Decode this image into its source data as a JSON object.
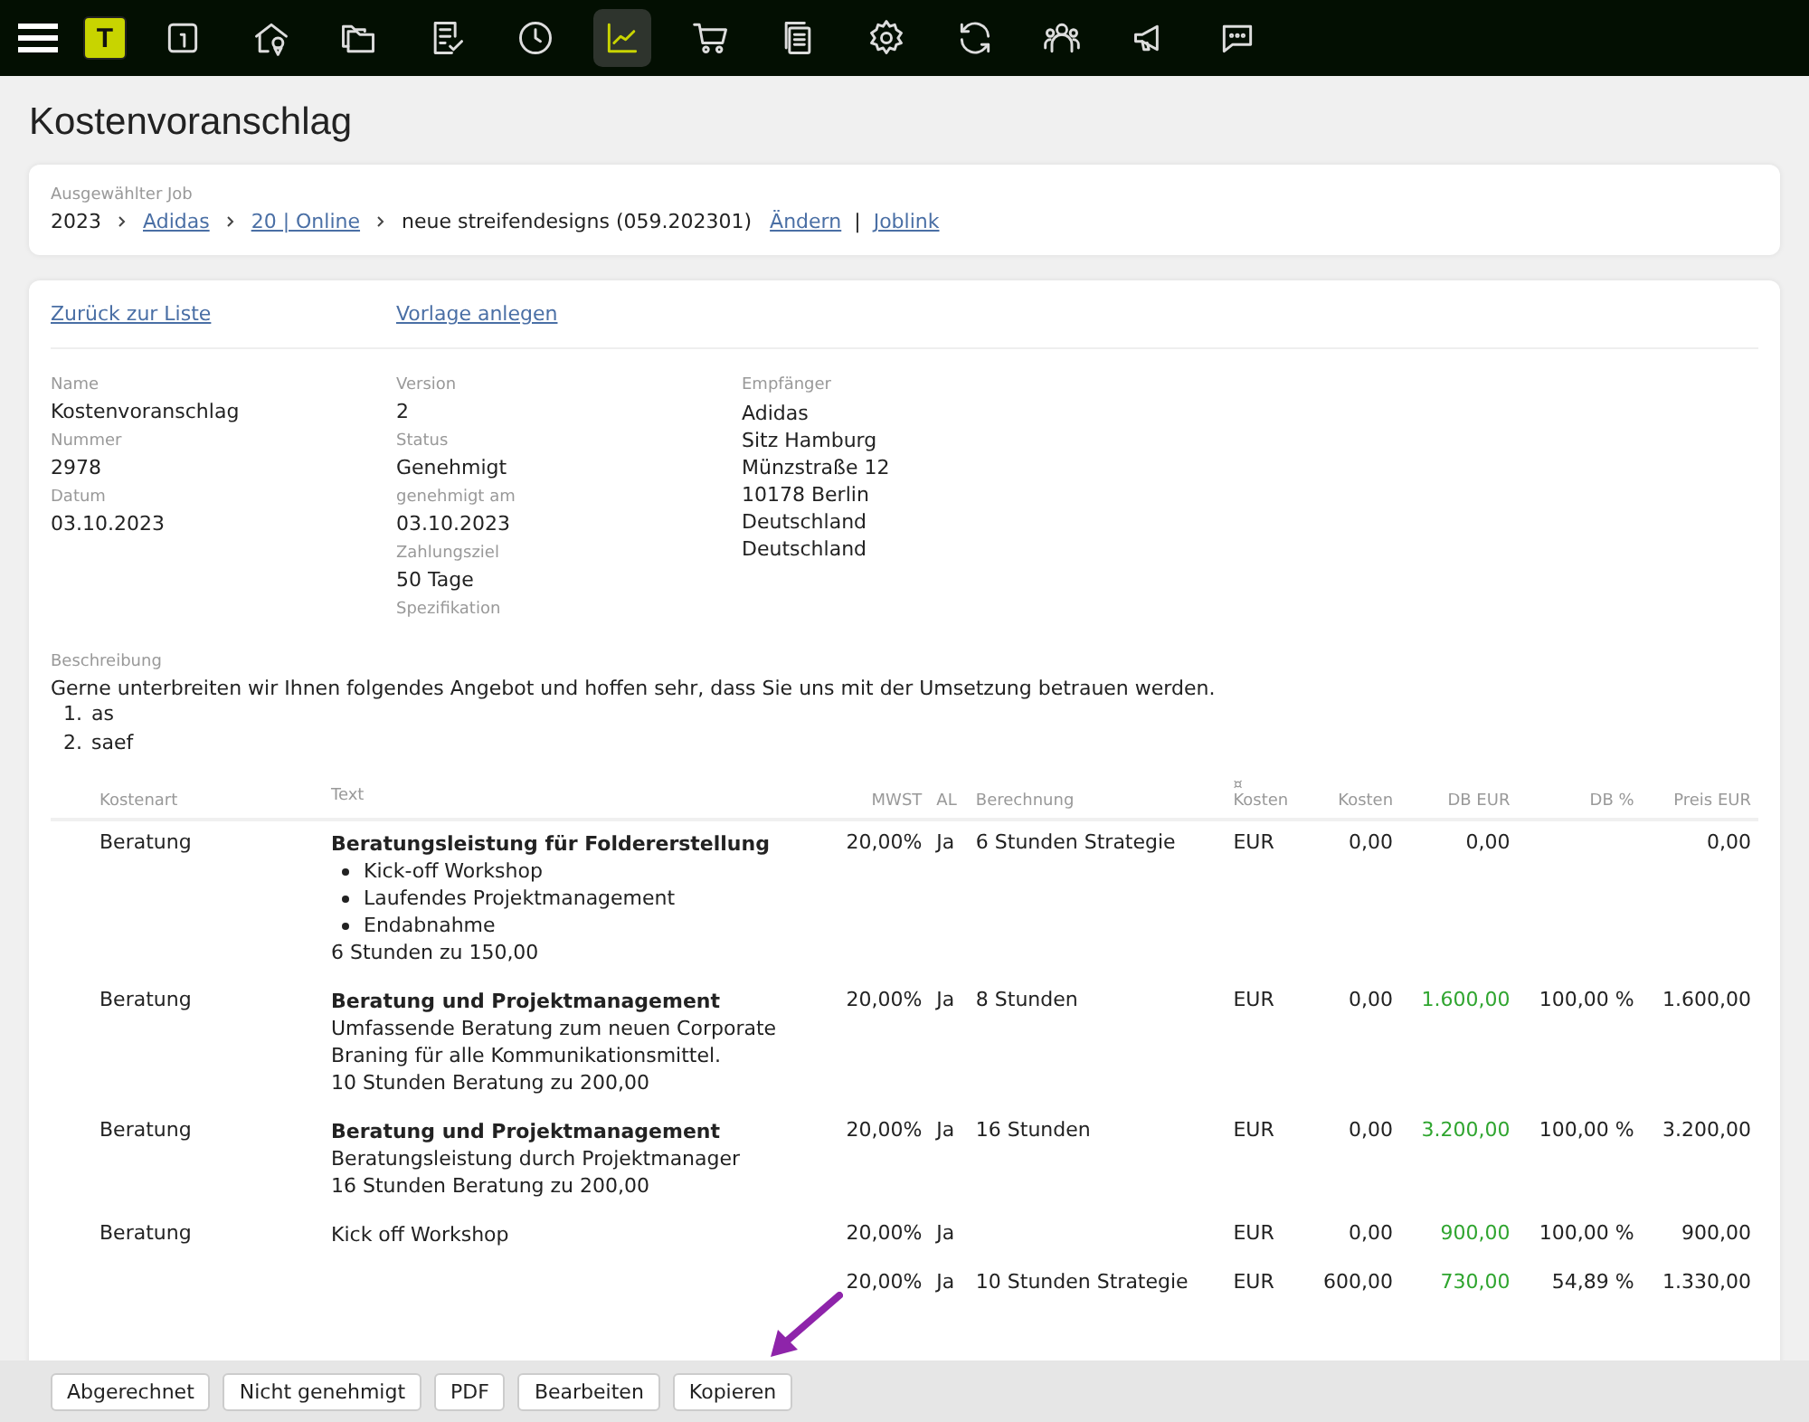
{
  "nav": {
    "logo": "T",
    "items": [
      {
        "selected": false
      },
      {
        "selected": false
      },
      {
        "selected": false
      },
      {
        "selected": false
      },
      {
        "selected": false
      },
      {
        "selected": true
      },
      {
        "selected": false
      },
      {
        "selected": false
      },
      {
        "selected": false
      },
      {
        "selected": false
      },
      {
        "selected": false
      },
      {
        "selected": false
      },
      {
        "selected": false
      }
    ]
  },
  "title": "Kostenvoranschlag",
  "job": {
    "label": "Ausgewählter Job",
    "crumbs": [
      {
        "text": "2023",
        "link": false
      },
      {
        "text": "Adidas",
        "link": true
      },
      {
        "text": "20 | Online",
        "link": true
      },
      {
        "text": "neue streifendesigns (059.202301)",
        "link": false
      }
    ],
    "change": "Ändern",
    "separator": "|",
    "joblink": "Joblink"
  },
  "links": [
    "Zurück zur Liste",
    "Vorlage anlegen"
  ],
  "fields": [
    [
      {
        "label": "Name",
        "value": "Kostenvoranschlag"
      },
      {
        "label": "Nummer",
        "value": "2978"
      },
      {
        "label": "Datum",
        "value": "03.10.2023"
      }
    ],
    [
      {
        "label": "Version",
        "value": "2"
      },
      {
        "label": "Status",
        "value": "Genehmigt"
      },
      {
        "label": "genehmigt am",
        "value": "03.10.2023"
      },
      {
        "label": "Zahlungsziel",
        "value": "50 Tage"
      },
      {
        "label": "Spezifikation"
      }
    ],
    [
      {
        "label": "Empfänger",
        "lines": [
          "Adidas",
          "Sitz Hamburg",
          "Münzstraße 12",
          "10178 Berlin",
          "Deutschland",
          "Deutschland"
        ]
      }
    ]
  ],
  "description": {
    "label": "Beschreibung",
    "text": "Gerne unterbreiten wir Ihnen folgendes Angebot und hoffen sehr, dass Sie uns mit der Umsetzung betrauen werden.",
    "items": [
      {
        "num": "1.",
        "text": "as"
      },
      {
        "num": "2.",
        "text": "saef"
      }
    ]
  },
  "table": {
    "columns": [
      {
        "label": "Kostenart"
      },
      {
        "label": "Text"
      },
      {
        "label": "MWST"
      },
      {
        "label": "AL"
      },
      {
        "label": "Berechnung"
      },
      {
        "symbol": "¤",
        "label": "Kosten"
      },
      {
        "label": "Kosten"
      },
      {
        "label": "DB EUR"
      },
      {
        "label": "DB %"
      },
      {
        "label": "Preis EUR"
      }
    ],
    "rows": [
      {
        "kostenart": "Beratung",
        "title": "Beratungsleistung für Foldererstellung",
        "bullets": [
          "Kick-off Workshop",
          "Laufendes Projektmanagement",
          "Endabnahme"
        ],
        "lines": [
          "6 Stunden zu 150,00"
        ],
        "mwst": "20,00%",
        "al": "Ja",
        "berechnung": "6 Stunden Strategie",
        "currency": "EUR",
        "kosten": "0,00",
        "db_eur": "0,00",
        "db_positive": false,
        "preis": "0,00"
      },
      {
        "kostenart": "Beratung",
        "title": "Beratung und Projektmanagement",
        "lines": [
          "Umfassende Beratung zum neuen Corporate Braning für alle Kommunikationsmittel.",
          "10 Stunden Beratung zu 200,00"
        ],
        "mwst": "20,00%",
        "al": "Ja",
        "berechnung": "8 Stunden",
        "currency": "EUR",
        "kosten": "0,00",
        "db_eur": "1.600,00",
        "db_positive": true,
        "db_pct": "100,00 %",
        "preis": "1.600,00"
      },
      {
        "kostenart": "Beratung",
        "title": "Beratung und Projektmanagement",
        "lines": [
          "Beratungsleistung durch Projektmanager",
          "16 Stunden Beratung zu 200,00"
        ],
        "mwst": "20,00%",
        "al": "Ja",
        "berechnung": "16 Stunden",
        "currency": "EUR",
        "kosten": "0,00",
        "db_eur": "3.200,00",
        "db_positive": true,
        "db_pct": "100,00 %",
        "preis": "3.200,00"
      },
      {
        "kostenart": "Beratung",
        "lines": [
          "Kick off Workshop"
        ],
        "mwst": "20,00%",
        "al": "Ja",
        "currency": "EUR",
        "kosten": "0,00",
        "db_eur": "900,00",
        "db_positive": true,
        "db_pct": "100,00 %",
        "preis": "900,00"
      },
      {
        "mwst": "20,00%",
        "al": "Ja",
        "berechnung": "10 Stunden Strategie",
        "currency": "EUR",
        "kosten": "600,00",
        "db_eur": "730,00",
        "db_positive": true,
        "db_pct": "54,89 %",
        "preis": "1.330,00"
      }
    ]
  },
  "actions": [
    "Abgerechnet",
    "Nicht genehmigt",
    "PDF",
    "Bearbeiten",
    "Kopieren"
  ]
}
